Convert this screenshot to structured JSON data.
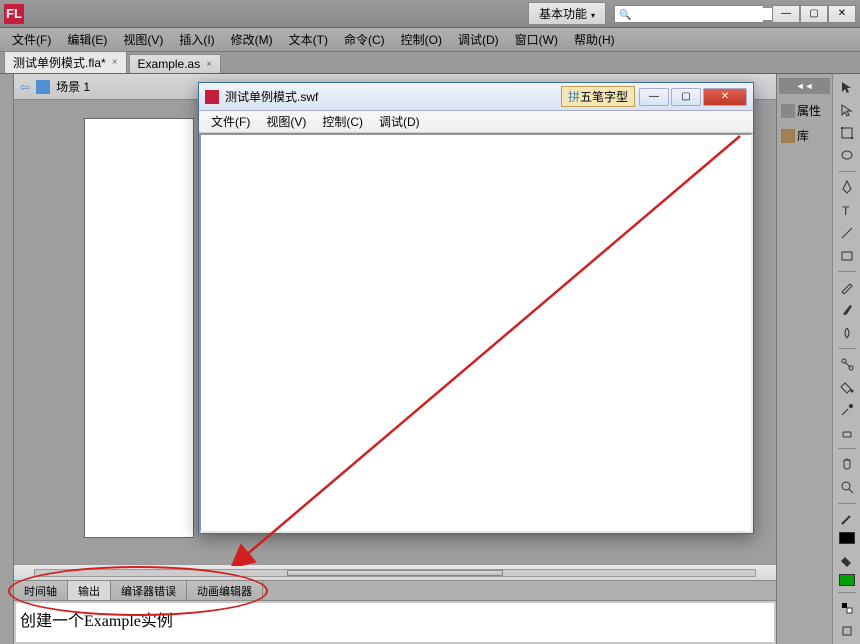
{
  "app": {
    "logo": "FL"
  },
  "titlebar": {
    "workspace_label": "基本功能",
    "search_placeholder": ""
  },
  "menu": {
    "items": [
      "文件(F)",
      "编辑(E)",
      "视图(V)",
      "插入(I)",
      "修改(M)",
      "文本(T)",
      "命令(C)",
      "控制(O)",
      "调试(D)",
      "窗口(W)",
      "帮助(H)"
    ]
  },
  "tabs": [
    {
      "label": "测试单例模式.fla*"
    },
    {
      "label": "Example.as"
    }
  ],
  "scene": {
    "label": "场景 1"
  },
  "right_panels": {
    "properties": "属性",
    "library": "库"
  },
  "bottom": {
    "tabs": [
      "时间轴",
      "输出",
      "编译器错误",
      "动画编辑器"
    ],
    "active_index": 1,
    "output_text": "创建一个Example实例"
  },
  "swf": {
    "title": "测试单例模式.swf",
    "ime": "五笔字型",
    "menu": [
      "文件(F)",
      "视图(V)",
      "控制(C)",
      "调试(D)"
    ]
  },
  "colors": {
    "accent_red": "#c41e3a",
    "annotation_red": "#d02020"
  }
}
